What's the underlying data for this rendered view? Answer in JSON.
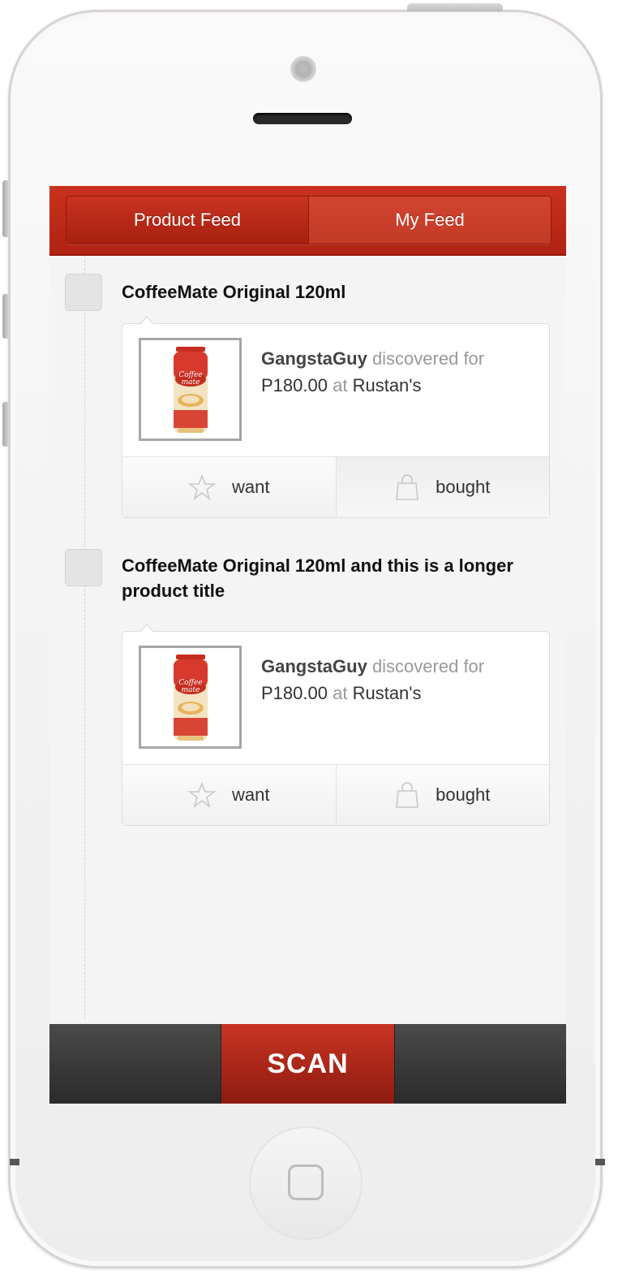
{
  "tabs": [
    {
      "label": "Product Feed"
    },
    {
      "label": "My Feed"
    }
  ],
  "posts": [
    {
      "title": "CoffeeMate Original 120ml",
      "user": "GangstaGuy",
      "discovered_text": "discovered for",
      "price": "P180.00",
      "at_text": "at",
      "store": "Rustan's",
      "want_label": "want",
      "bought_label": "bought"
    },
    {
      "title": "CoffeeMate Original 120ml and this is a longer product title",
      "user": "GangstaGuy",
      "discovered_text": "discovered for",
      "price": "P180.00",
      "at_text": "at",
      "store": "Rustan's",
      "want_label": "want",
      "bought_label": "bought"
    }
  ],
  "product_image": {
    "brand": "Coffee-mate",
    "tagline": "The Original"
  },
  "scan_label": "SCAN",
  "colors": {
    "brand_red": "#c2301e",
    "bar_dark": "#333333"
  }
}
